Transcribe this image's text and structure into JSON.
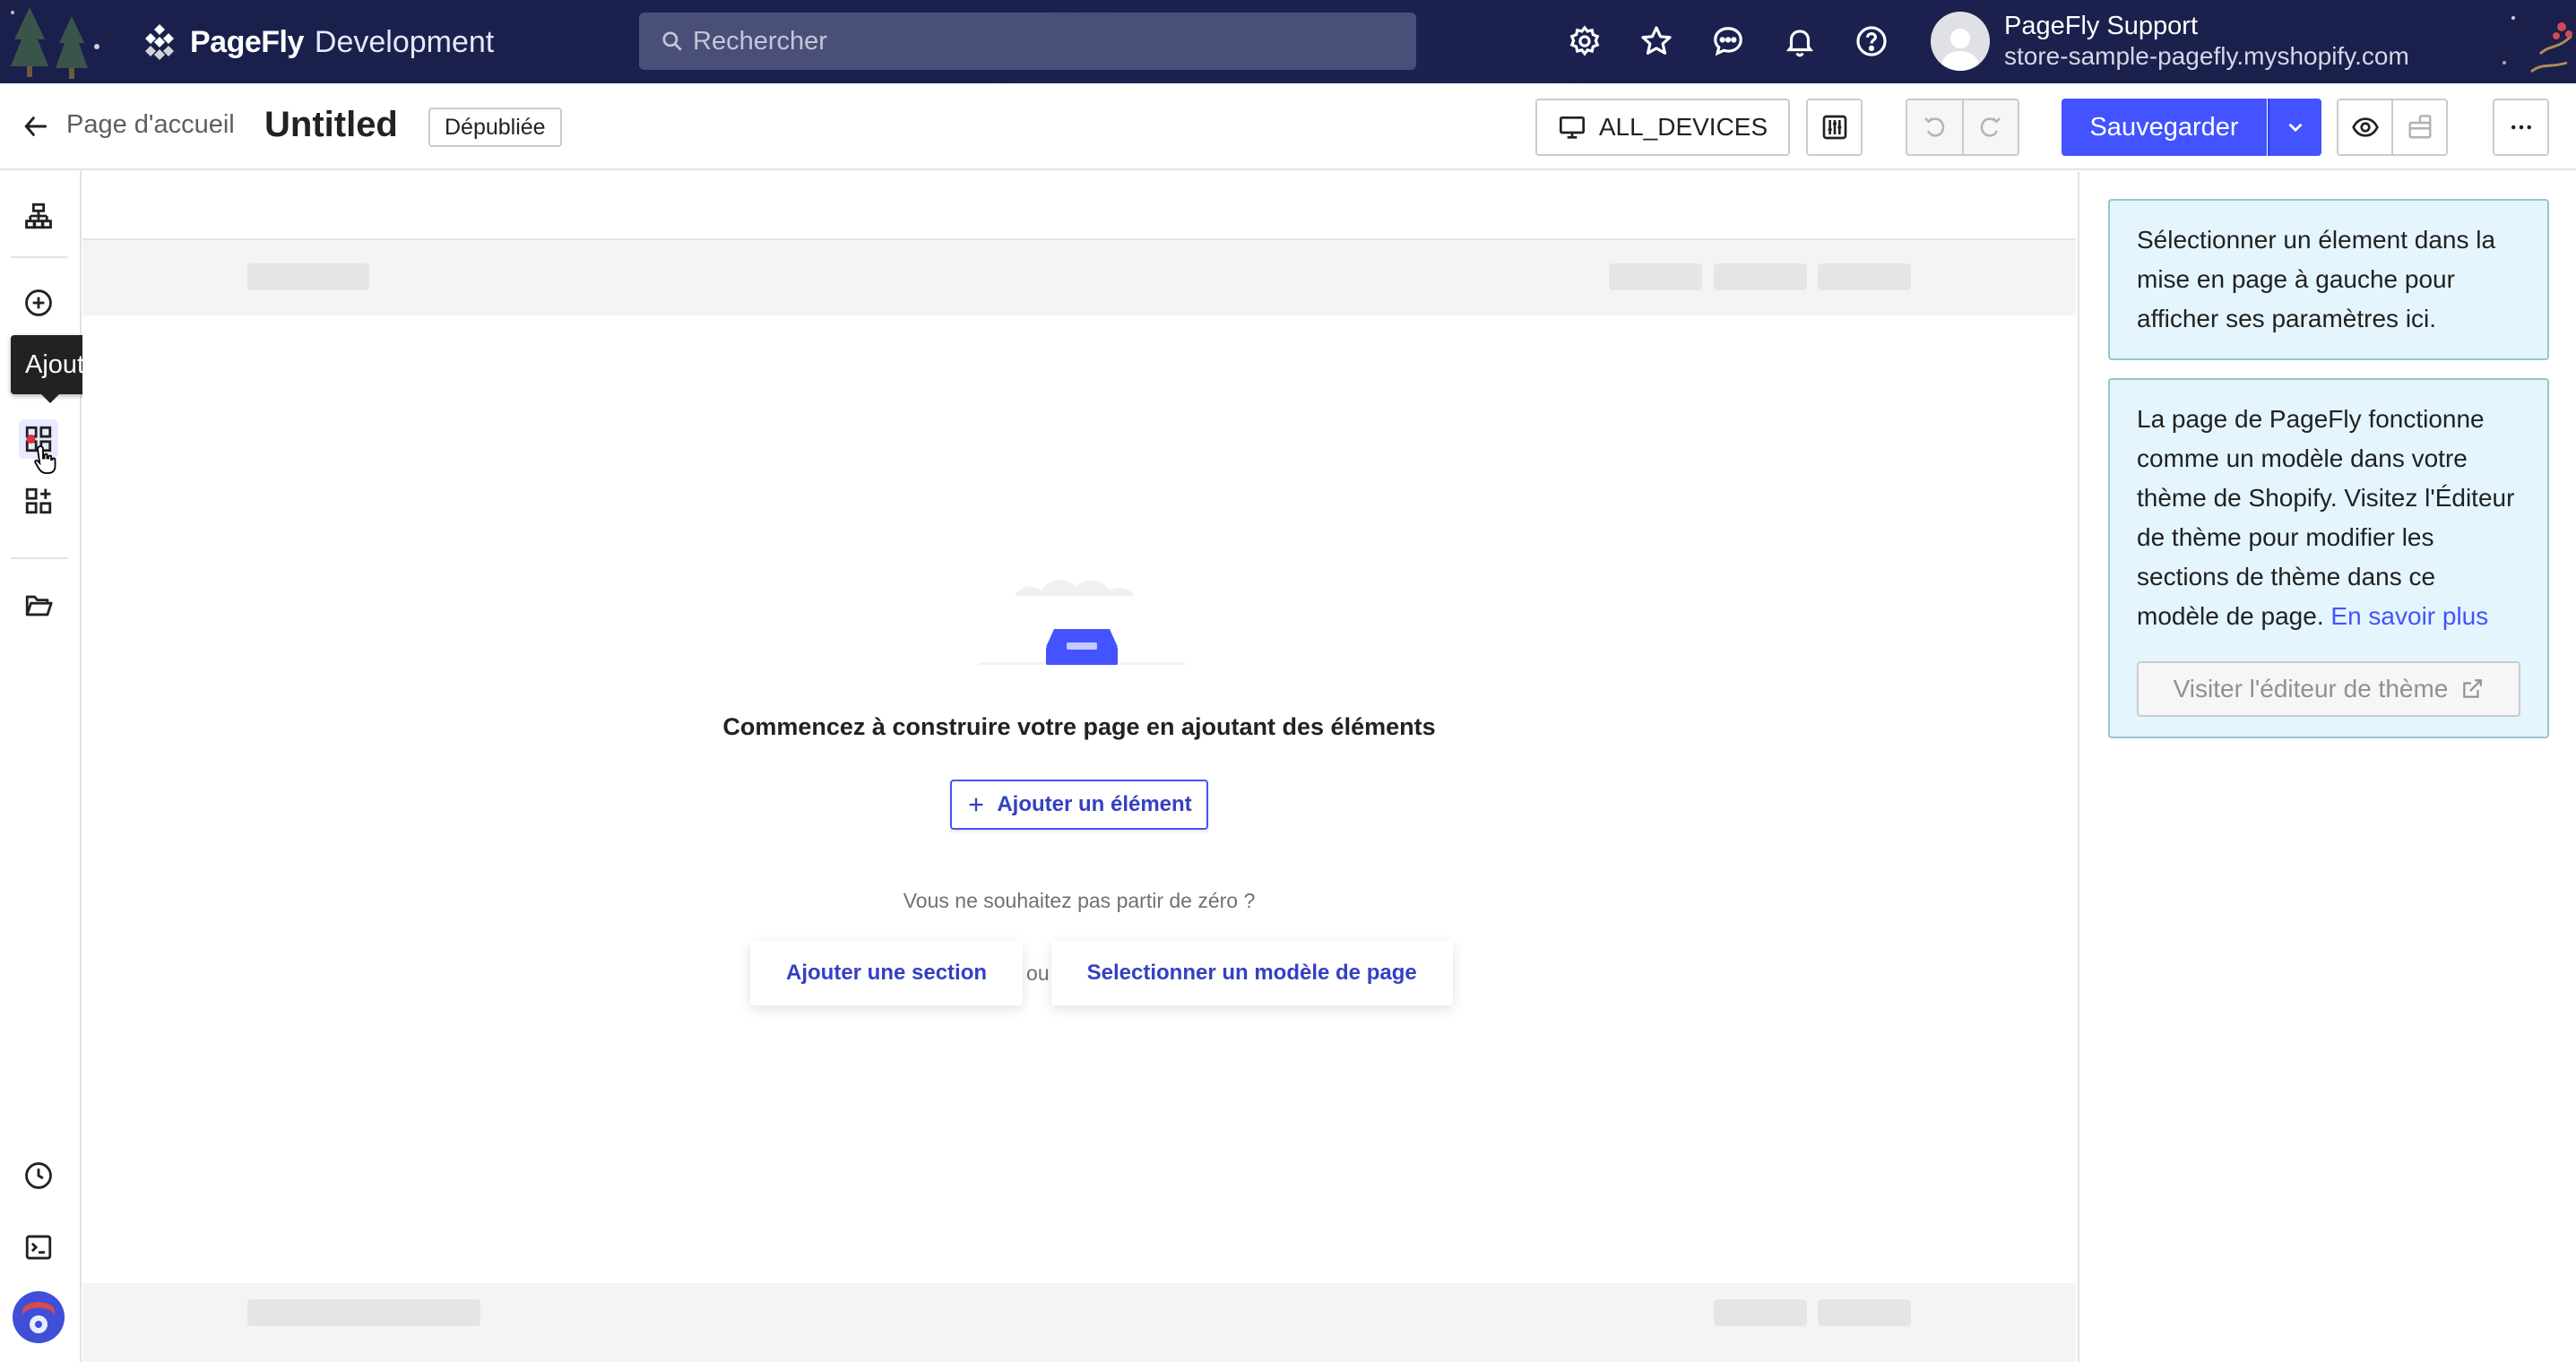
{
  "topbar": {
    "brand_name": "PageFly",
    "brand_sub": "Development",
    "search_placeholder": "Rechercher",
    "user_name": "PageFly Support",
    "user_store": "store-sample-pagefly.myshopify.com"
  },
  "toolbar": {
    "back_label": "Page d'accueil",
    "page_title": "Untitled",
    "status": "Dépubliée",
    "device": "ALL_DEVICES",
    "save_label": "Sauvegarder"
  },
  "rail": {
    "tooltip": "Ajouter un élément tiers"
  },
  "canvas": {
    "empty_title": "Commencez à construire votre page en ajoutant des éléments",
    "add_element": "Ajouter un élément",
    "subtitle": "Vous ne souhaitez pas partir de zéro ?",
    "add_section": "Ajouter une section",
    "or": "ou",
    "select_template": "Selectionner un modèle de page"
  },
  "panel": {
    "hint": "Sélectionner un élement dans la mise en page à gauche pour afficher ses paramètres ici.",
    "info": "La page de PageFly fonctionne comme un modèle dans votre thème de Shopify. Visitez l'Éditeur de thème pour modifier les sections de thème dans ce modèle de page.",
    "learn_more": "En savoir plus",
    "visit_theme": "Visiter l'éditeur de thème"
  },
  "colors": {
    "accent": "#4353ff",
    "topbar_bg": "#1a1f4b",
    "info_bg": "#e5f5fd"
  }
}
